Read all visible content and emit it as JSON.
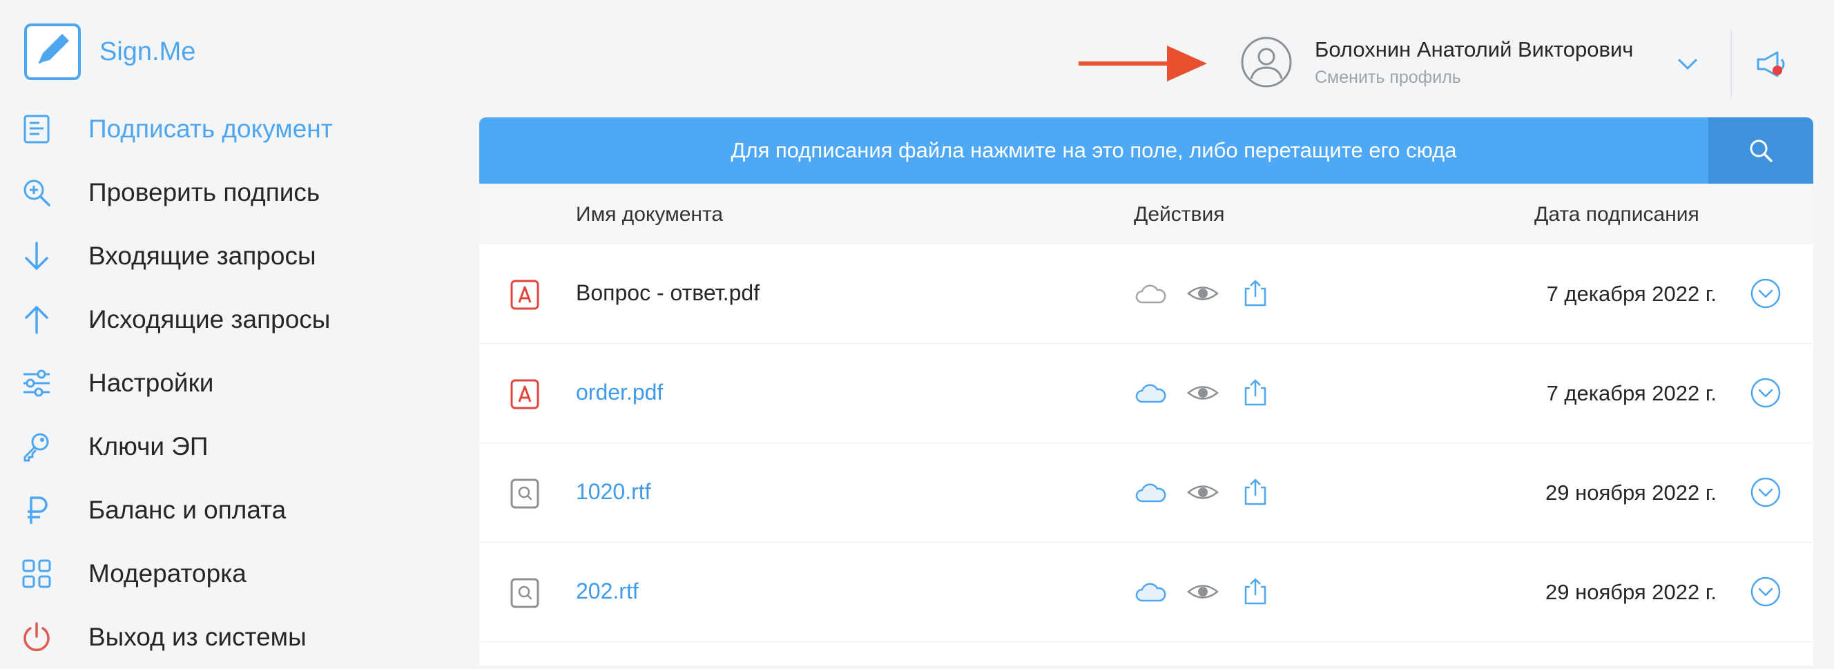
{
  "app": {
    "name": "Sign.Me"
  },
  "sidebar": {
    "items": [
      {
        "label": "Подписать документ",
        "icon": "document-icon",
        "active": true
      },
      {
        "label": "Проверить подпись",
        "icon": "magnifier-plus-icon"
      },
      {
        "label": "Входящие запросы",
        "icon": "arrow-down-icon"
      },
      {
        "label": "Исходящие запросы",
        "icon": "arrow-up-icon"
      },
      {
        "label": "Настройки",
        "icon": "sliders-icon"
      },
      {
        "label": "Ключи ЭП",
        "icon": "key-icon"
      },
      {
        "label": "Баланс и оплата",
        "icon": "ruble-icon"
      },
      {
        "label": "Модераторка",
        "icon": "grid-icon"
      },
      {
        "label": "Выход из системы",
        "icon": "power-icon"
      }
    ]
  },
  "header": {
    "user_name": "Болохнин Анатолий Викторович",
    "switch_profile": "Сменить профиль"
  },
  "upload": {
    "dropzone_text": "Для подписания файла нажмите на это поле, либо перетащите его сюда"
  },
  "table": {
    "columns": {
      "name": "Имя документа",
      "actions": "Действия",
      "date": "Дата подписания"
    },
    "rows": [
      {
        "name": "Вопрос - ответ.pdf",
        "date": "7 декабря 2022 г.",
        "type": "pdf",
        "link": false
      },
      {
        "name": "order.pdf",
        "date": "7 декабря 2022 г.",
        "type": "pdf",
        "link": true
      },
      {
        "name": "1020.rtf",
        "date": "29 ноября 2022 г.",
        "type": "rtf",
        "link": true
      },
      {
        "name": "202.rtf",
        "date": "29 ноября 2022 г.",
        "type": "rtf",
        "link": true
      }
    ]
  },
  "colors": {
    "accent": "#4ea6ef",
    "dropzone": "#4ea8f4",
    "search_button": "#3f93de",
    "pdf_red": "#e2453c",
    "arrow_orange": "#e8502f",
    "notification_dot": "#e84040"
  }
}
